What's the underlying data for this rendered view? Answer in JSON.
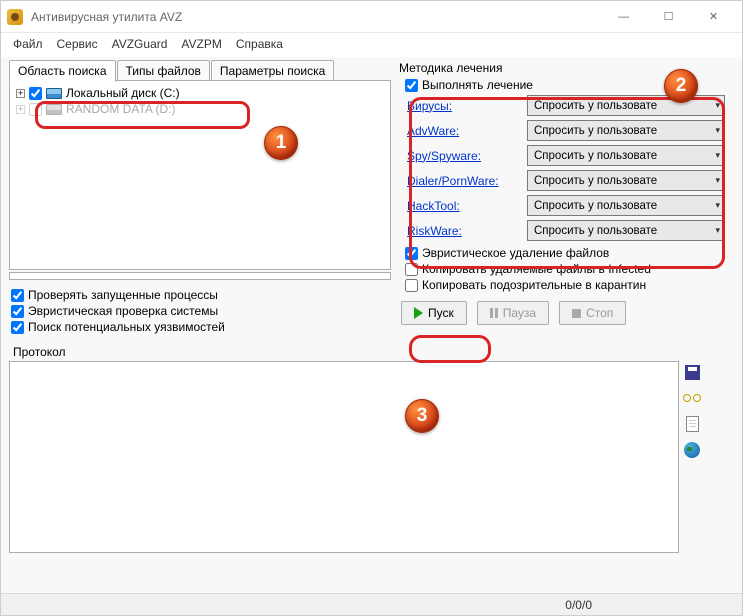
{
  "window": {
    "title": "Антивирусная утилита AVZ"
  },
  "menu": {
    "items": [
      "Файл",
      "Сервис",
      "AVZGuard",
      "AVZPM",
      "Справка"
    ]
  },
  "left_tabs": {
    "items": [
      "Область поиска",
      "Типы файлов",
      "Параметры поиска"
    ],
    "active": 0
  },
  "tree": {
    "rows": [
      {
        "expand": "+",
        "checked": true,
        "label": "Локальный диск (C:)"
      },
      {
        "expand": "+",
        "checked": false,
        "label": "RANDOM DATA (D:)"
      }
    ]
  },
  "left_checks": [
    {
      "checked": true,
      "label": "Проверять запущенные процессы"
    },
    {
      "checked": true,
      "label": "Эвристическая проверка системы"
    },
    {
      "checked": true,
      "label": "Поиск потенциальных уязвимостей"
    }
  ],
  "right": {
    "section": "Методика лечения",
    "perform_cure_label": "Выполнять лечение",
    "perform_cure_checked": true,
    "threat_rows": [
      {
        "label": "Вирусы:",
        "value": "Спросить у пользовате"
      },
      {
        "label": "AdvWare:",
        "value": "Спросить у пользовате"
      },
      {
        "label": "Spy/Spyware:",
        "value": "Спросить у пользовате"
      },
      {
        "label": "Dialer/PornWare:",
        "value": "Спросить у пользовате"
      },
      {
        "label": "HackTool:",
        "value": "Спросить у пользовате"
      },
      {
        "label": "RiskWare:",
        "value": "Спросить у пользовате"
      }
    ],
    "bottom_checks": [
      {
        "checked": true,
        "label": "Эвристическое удаление файлов"
      },
      {
        "checked": false,
        "label": "Копировать удаляемые файлы в Infected"
      },
      {
        "checked": false,
        "label": "Копировать подозрительные в карантин"
      }
    ]
  },
  "buttons": {
    "start": "Пуск",
    "pause": "Пауза",
    "stop": "Стоп"
  },
  "protocol": {
    "label": "Протокол"
  },
  "status": {
    "counters": "0/0/0"
  },
  "callouts": {
    "c1": "1",
    "c2": "2",
    "c3": "3"
  }
}
